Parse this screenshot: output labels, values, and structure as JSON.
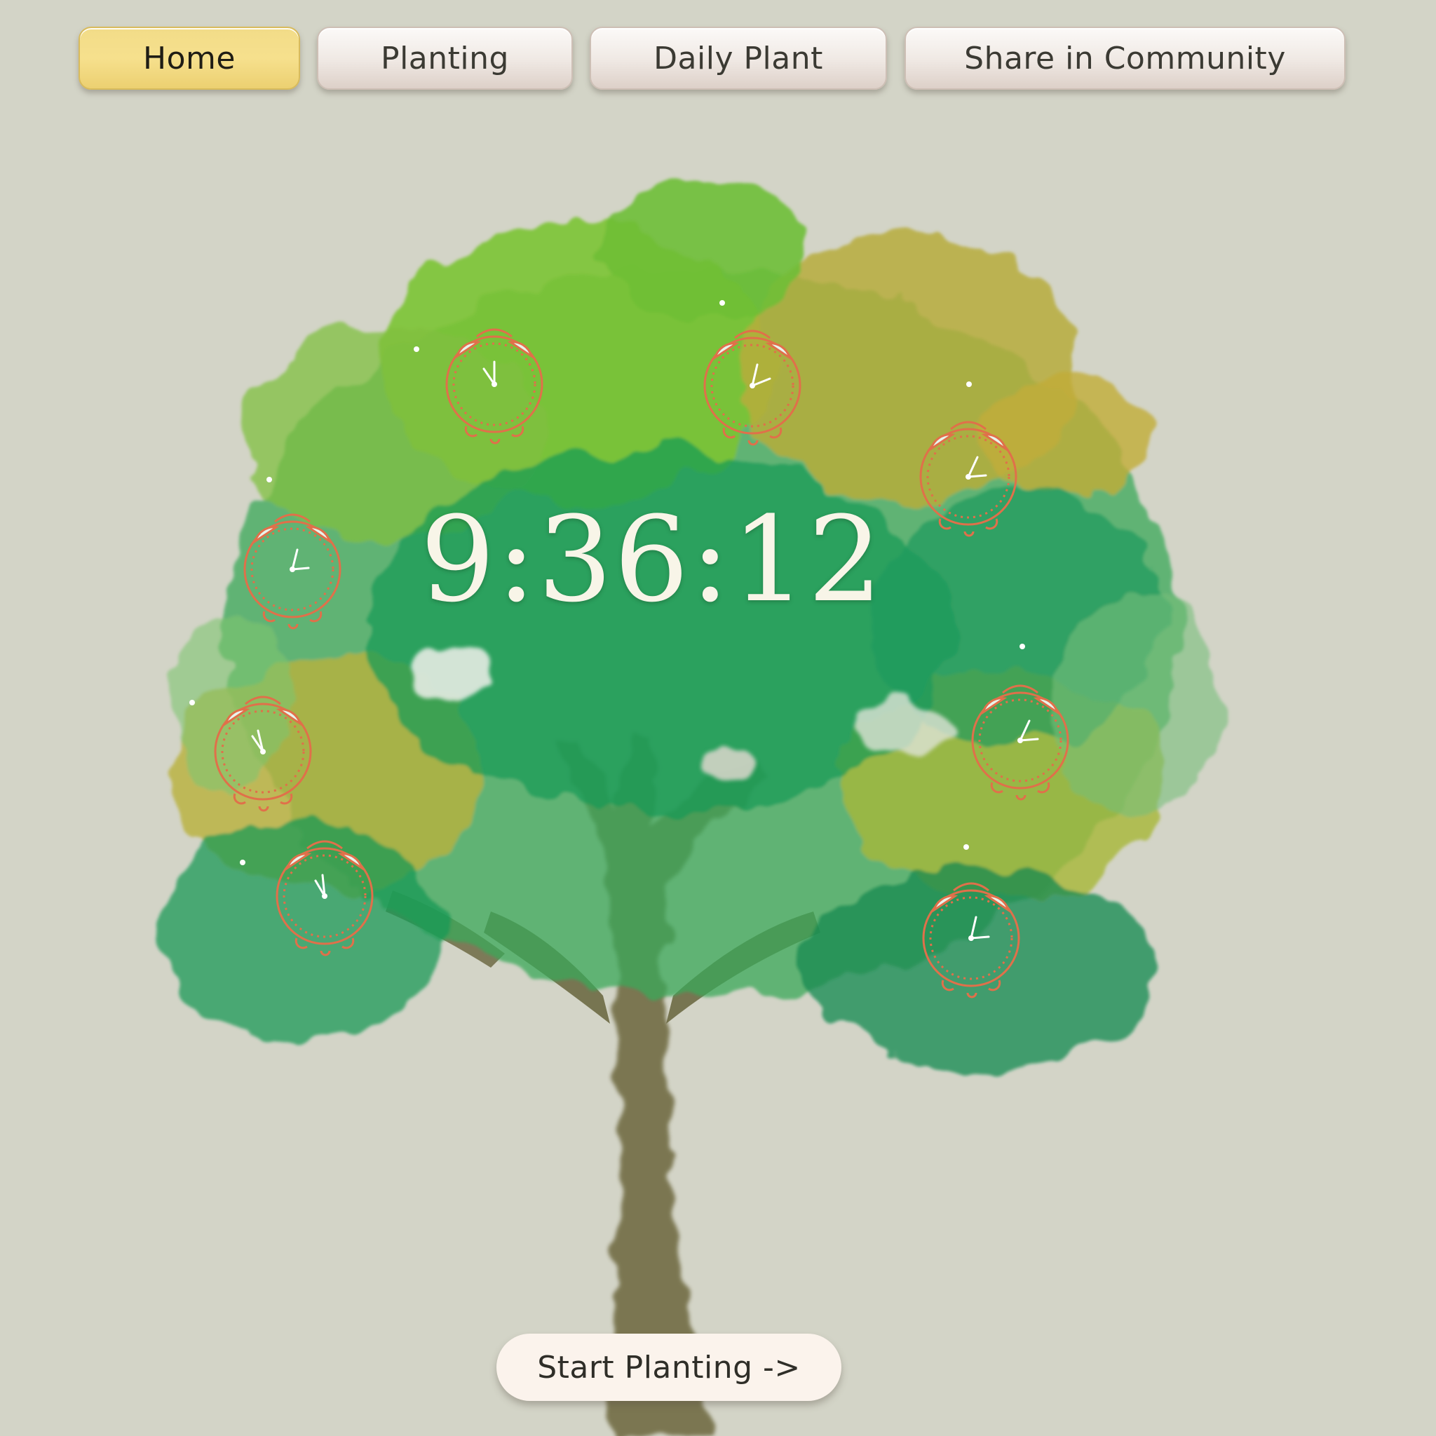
{
  "nav": {
    "items": [
      {
        "label": "Home",
        "active": true
      },
      {
        "label": "Planting",
        "active": false
      },
      {
        "label": "Daily Plant",
        "active": false
      },
      {
        "label": "Share in Community",
        "active": false
      }
    ]
  },
  "timer": {
    "time": "9:36:12"
  },
  "cta": {
    "label": "Start Planting ->"
  },
  "colors": {
    "background": "#d3d4c7",
    "active_tab": "#f4dc87",
    "alarm_icon": "#e0704a",
    "time_text": "#f8f5e8"
  },
  "icons": [
    "alarm-clock-icon"
  ]
}
